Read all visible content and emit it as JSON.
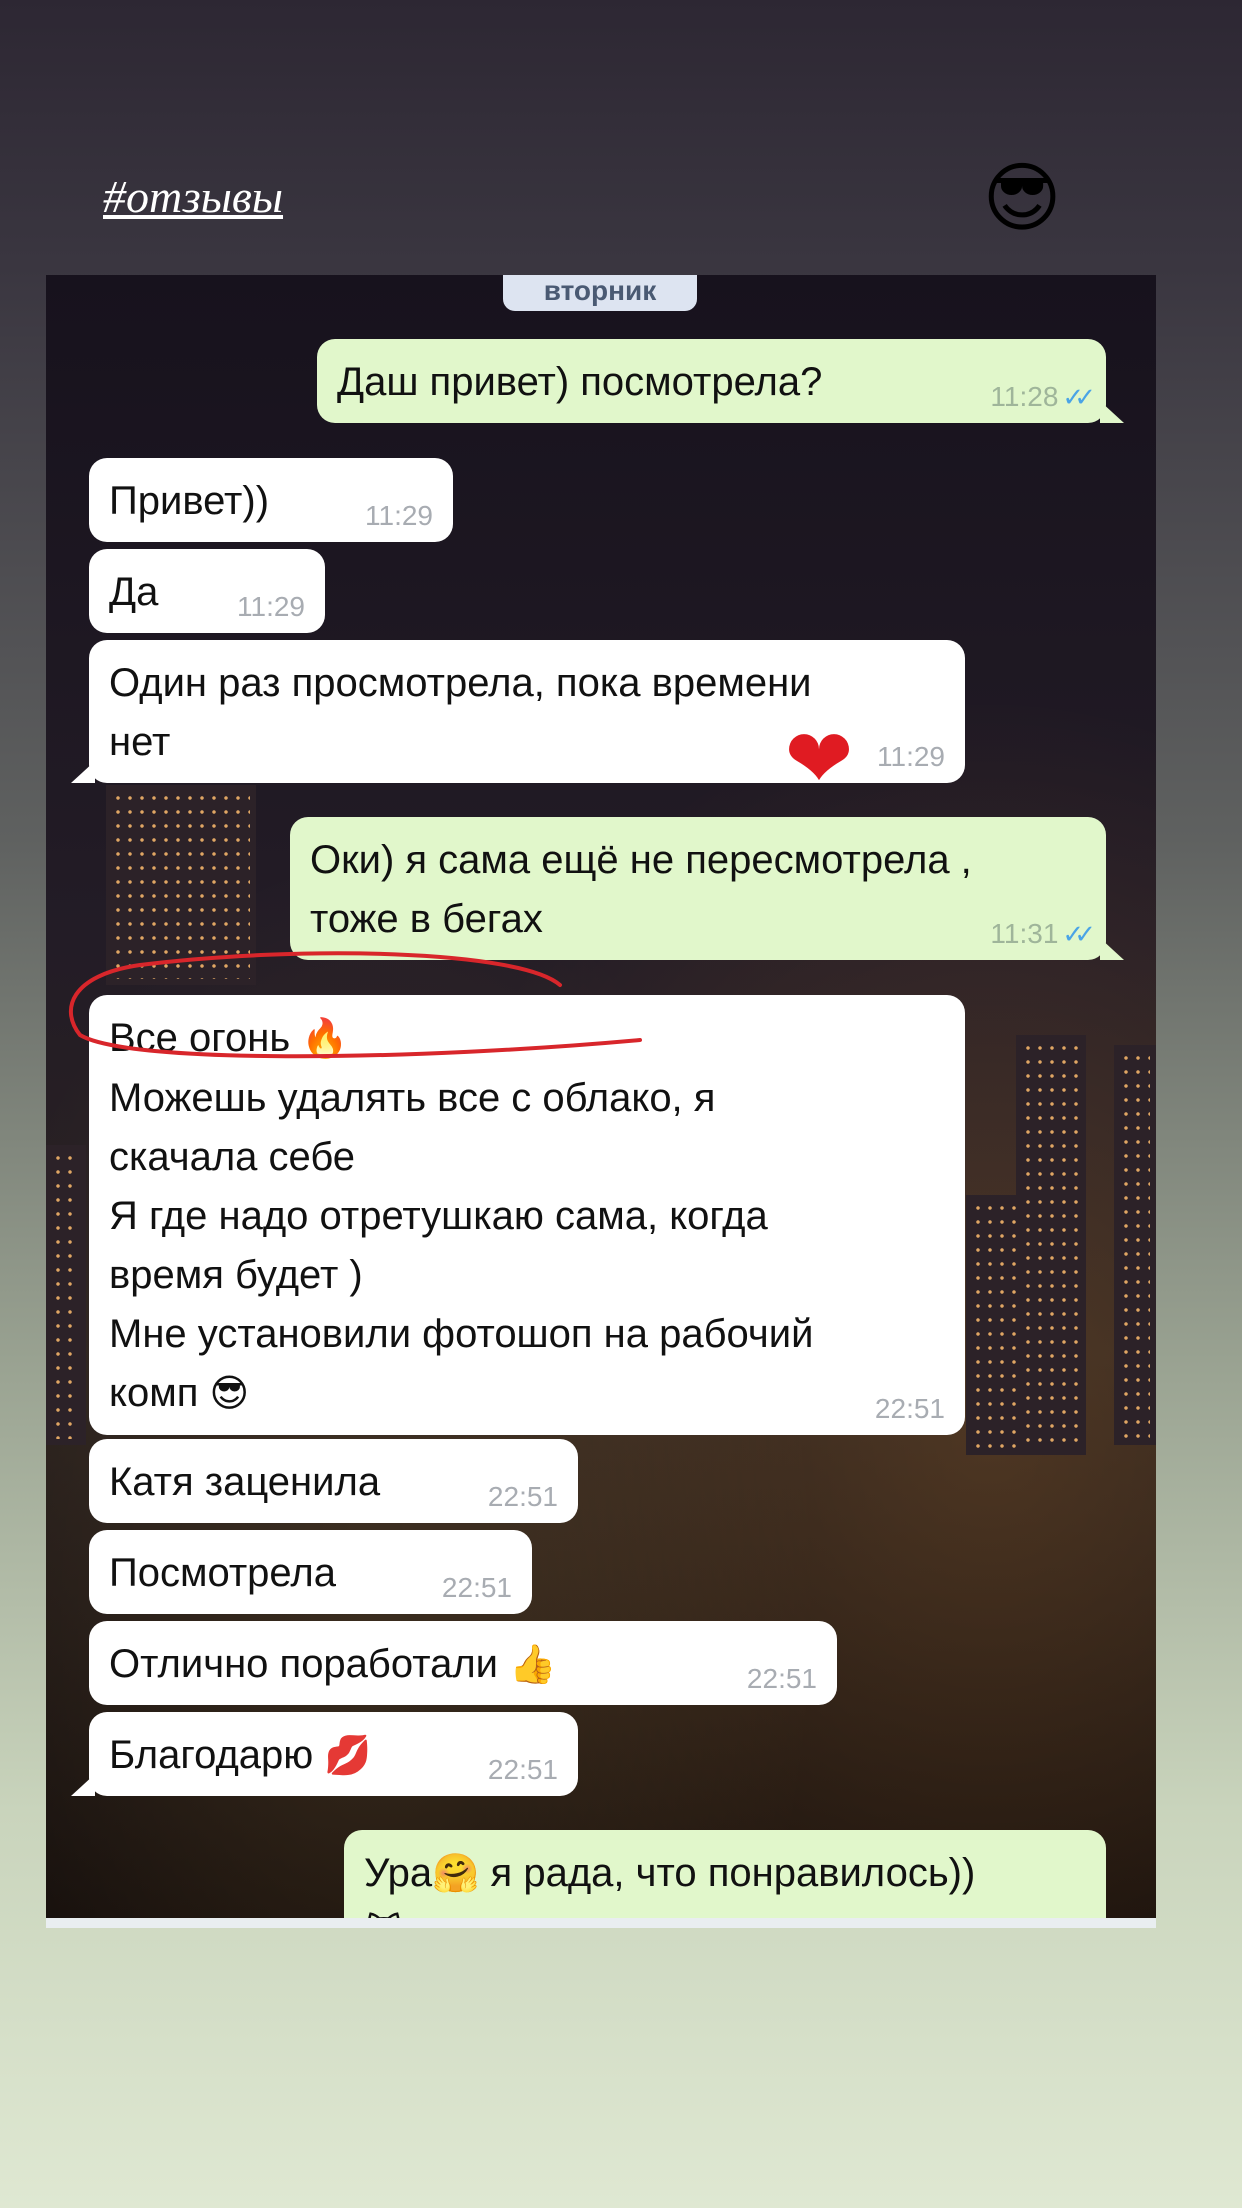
{
  "header": {
    "hashtag": "#отзывы",
    "emoji": "😎"
  },
  "chat": {
    "day_label": "вторник",
    "messages": [
      {
        "dir": "out",
        "text": "Даш привет) посмотрела?",
        "time": "11:28",
        "ticks": "✓✓"
      },
      {
        "dir": "in",
        "text": "Привет))",
        "time": "11:29"
      },
      {
        "dir": "in",
        "text": "Да",
        "time": "11:29"
      },
      {
        "dir": "in",
        "lines": [
          "Один раз просмотрела, пока времени",
          "нет"
        ],
        "time": "11:29"
      },
      {
        "dir": "out",
        "lines": [
          "Оки) я сама ещё не пересмотрела ,",
          "тоже в бегах"
        ],
        "time": "11:31",
        "ticks": "✓✓"
      },
      {
        "dir": "in",
        "lines": [
          "Все огонь",
          "Можешь удалять все с облако, я",
          "скачала себе",
          "Я где надо отретушкаю сама, когда",
          "время будет )",
          "Мне установили фотошоп на рабочий",
          "комп"
        ],
        "emojis": [
          "🔥",
          "😎"
        ],
        "time": "22:51"
      },
      {
        "dir": "in",
        "text": "Катя заценила",
        "time": "22:51"
      },
      {
        "dir": "in",
        "text": "Посмотрела",
        "time": "22:51"
      },
      {
        "dir": "in",
        "text": "Отлично поработали",
        "emoji": "👍",
        "time": "22:51"
      },
      {
        "dir": "in",
        "text": "Благодарю",
        "emoji": "💋",
        "time": "22:51"
      },
      {
        "dir": "out",
        "text_a": "Ура",
        "emoji_a": "🤗",
        "text_b": " я рада, что понравилось))",
        "emoji_b": "😻"
      }
    ]
  },
  "overlay": {
    "heart": "❤",
    "annotation_color": "#d8262b"
  }
}
